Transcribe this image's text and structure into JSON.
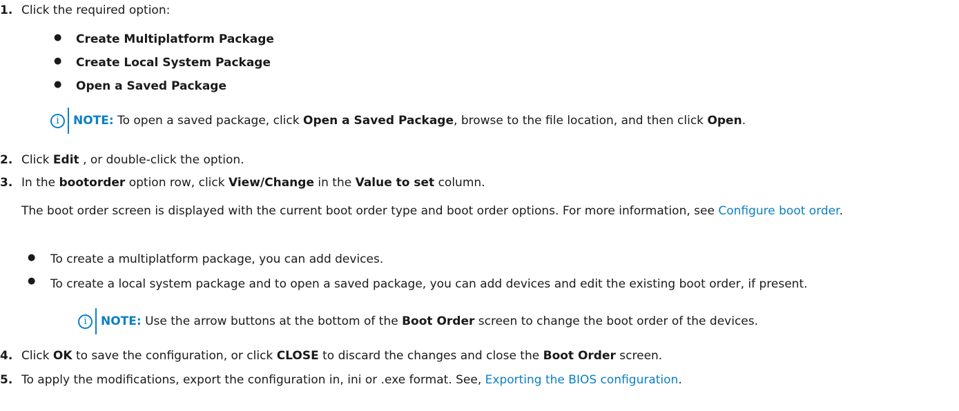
{
  "steps": [
    {
      "num": "1.",
      "text": "Click the required option:"
    },
    {
      "num": "2.",
      "pre": "Click ",
      "b1": "Edit",
      "post": " , or double-click the option."
    },
    {
      "num": "3.",
      "pre": "In the ",
      "b1": "bootorder",
      "mid1": " option row, click ",
      "b2": "View/Change",
      "mid2": " in the ",
      "b3": "Value to set",
      "post": " column."
    },
    {
      "num": "4.",
      "pre": "Click ",
      "b1": "OK",
      "mid1": " to save the configuration, or click ",
      "b2": "CLOSE",
      "mid2": " to discard the changes and close the ",
      "b3": "Boot Order",
      "post": " screen."
    },
    {
      "num": "5.",
      "pre": "To apply the modifications, export the configuration in, ini or .exe format. See, ",
      "link": "Exporting the BIOS configuration",
      "post": "."
    }
  ],
  "options": [
    "Create Multiplatform Package",
    "Create Local System Package",
    "Open a Saved Package"
  ],
  "bullet_glyph": "●",
  "note_icon": "i",
  "note1": {
    "label": "NOTE:",
    "pre": " To open a saved package, click ",
    "b1": "Open a Saved Package",
    "mid": ", browse to the file location, and then click ",
    "b2": "Open",
    "post": "."
  },
  "step3_para": {
    "text": "The boot order screen is displayed with the current boot order type and boot order options. For more information, see ",
    "link": "Configure boot order",
    "post": "."
  },
  "step3_list": [
    "To create a multiplatform package, you can add devices.",
    "To create a local system package and to open a saved package, you can add devices and edit the existing boot order, if present."
  ],
  "note2": {
    "label": "NOTE:",
    "pre": " Use the arrow buttons at the bottom of the ",
    "b1": "Boot Order",
    "post": " screen to change the boot order of the devices."
  }
}
